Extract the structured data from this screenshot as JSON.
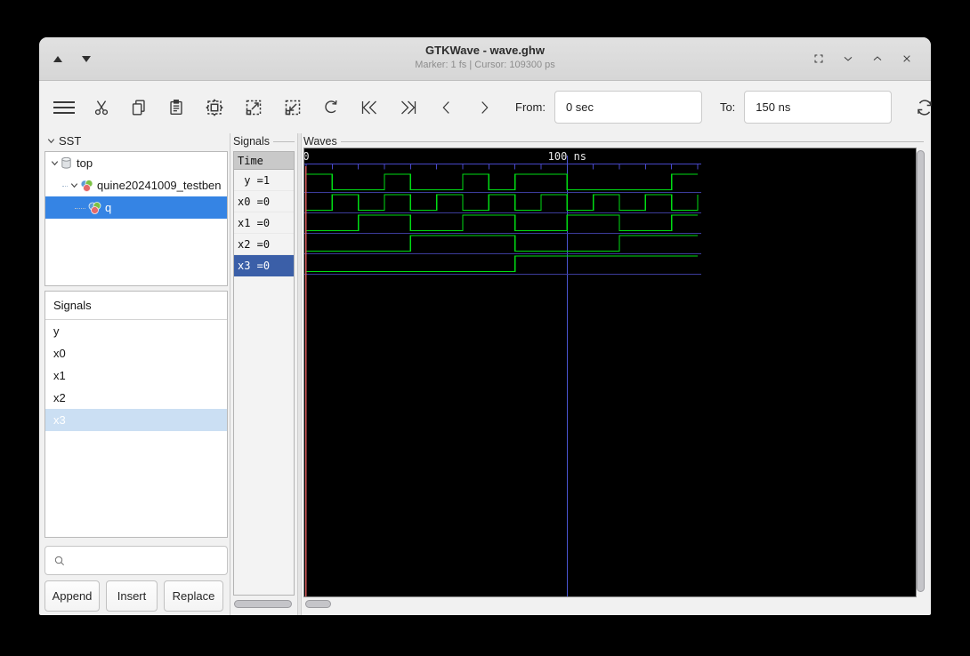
{
  "titlebar": {
    "title": "GTKWave - wave.ghw",
    "status": "Marker: 1 fs | Cursor: 109300 ps",
    "left_controls": [
      "raise-window",
      "lower-window"
    ],
    "right_controls": [
      "fullscreen",
      "minimize",
      "maximize",
      "close"
    ]
  },
  "toolbar": {
    "icons": [
      "menu",
      "cut",
      "copy",
      "paste",
      "zoom-fit",
      "zoom-in",
      "zoom-out",
      "undo",
      "skip-to-start",
      "skip-to-end",
      "step-back",
      "step-forward",
      "reload"
    ],
    "from_label": "From:",
    "from_value": "0 sec",
    "to_label": "To:",
    "to_value": "150 ns"
  },
  "sst_panel": {
    "header": "SST",
    "tree": [
      {
        "label": "top",
        "depth": 0,
        "icon": "cylinder",
        "expander": true,
        "selected": false
      },
      {
        "label": "quine20241009_testben",
        "depth": 1,
        "icon": "module",
        "expander": true,
        "selected": false
      },
      {
        "label": "q",
        "depth": 2,
        "icon": "module",
        "expander": false,
        "selected": true
      }
    ]
  },
  "signals_list": {
    "header": "Signals",
    "items": [
      {
        "label": "y",
        "selected": false
      },
      {
        "label": "x0",
        "selected": false
      },
      {
        "label": "x1",
        "selected": false
      },
      {
        "label": "x2",
        "selected": false
      },
      {
        "label": "x3",
        "selected": true
      }
    ]
  },
  "filter": {
    "placeholder": ""
  },
  "actions": {
    "append": "Append",
    "insert": "Insert",
    "replace": "Replace"
  },
  "values_panel": {
    "frame_label": "Signals",
    "time_header": "Time",
    "rows": [
      {
        "text": " y =1",
        "selected": false
      },
      {
        "text": "x0 =0",
        "selected": false
      },
      {
        "text": "x1 =0",
        "selected": false
      },
      {
        "text": "x2 =0",
        "selected": false
      },
      {
        "text": "x3 =0",
        "selected": true
      }
    ]
  },
  "waves_panel": {
    "frame_label": "Waves"
  },
  "chart_data": {
    "type": "digital-waveform",
    "time_unit": "ns",
    "t_start": 0,
    "t_end": 150,
    "tick_step": 10,
    "ruler_labels": [
      {
        "t": 0,
        "text": "0"
      },
      {
        "t": 100,
        "text": "100 ns"
      }
    ],
    "marker_t": 0,
    "cursor_t": 100,
    "signals": [
      {
        "name": "y",
        "initial": 1,
        "toggles": [
          10,
          30,
          40,
          60,
          70,
          80,
          100,
          140
        ]
      },
      {
        "name": "x0",
        "initial": 0,
        "toggles": [
          10,
          20,
          30,
          40,
          50,
          60,
          70,
          80,
          90,
          100,
          110,
          120,
          130,
          140,
          150
        ]
      },
      {
        "name": "x1",
        "initial": 0,
        "toggles": [
          20,
          40,
          60,
          80,
          100,
          120,
          140
        ]
      },
      {
        "name": "x2",
        "initial": 0,
        "toggles": [
          40,
          80,
          120
        ]
      },
      {
        "name": "x3",
        "initial": 0,
        "toggles": [
          80
        ]
      }
    ],
    "colors": {
      "background": "#000000",
      "trace": "#00dc14",
      "ruler": "#4848c8",
      "row_baseline": "#3c3c9b",
      "cursor": "#4a55d2",
      "marker": "#d45b5b",
      "label_text": "#e8e8e8"
    }
  }
}
